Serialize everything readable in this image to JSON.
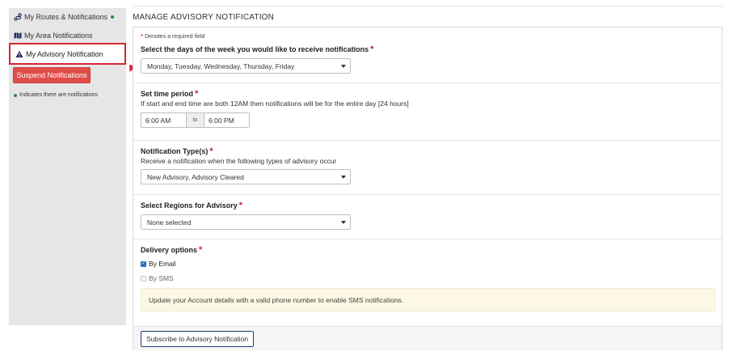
{
  "sidebar": {
    "items": [
      {
        "label": "My Routes & Notifications",
        "icon": "route-icon",
        "has_notifications": true
      },
      {
        "label": "My Area Notifications",
        "icon": "map-icon",
        "has_notifications": false
      },
      {
        "label": "My Advisory Notification",
        "icon": "warning-icon",
        "active": true
      }
    ],
    "suspend_button": "Suspend Notifications",
    "legend": "Indicates there are notifications",
    "notification_dot_color": "#2e8b3a"
  },
  "main": {
    "title": "MANAGE ADVISORY NOTIFICATION",
    "required_note": "Denotes a required field",
    "required_star": "*",
    "days": {
      "label": "Select the days of the week you would like to receive notifications",
      "value": "Monday, Tuesday, Wednesday, Thursday, Friday"
    },
    "time_period": {
      "label": "Set time period",
      "help": "If start and end time are both 12AM then notifications will be for the entire day [24 hours]",
      "start": "6:00 AM",
      "separator": "to",
      "end": "6:00 PM"
    },
    "types": {
      "label": "Notification Type(s)",
      "help": "Receive a notification when the following types of advisory occur",
      "value": "New Advisory, Advisory Cleared"
    },
    "regions": {
      "label": "Select Regions for Advisory",
      "value": "None selected"
    },
    "delivery": {
      "label": "Delivery options",
      "email": {
        "label": "By Email",
        "checked": true
      },
      "sms": {
        "label": "By SMS",
        "checked": false,
        "disabled": true
      },
      "alert": "Update your Account details with a valid phone number to enable SMS notifications."
    },
    "subscribe_button": "Subscribe to Advisory Notification"
  },
  "colors": {
    "accent_red": "#d3272d",
    "suspend_button": "#e04d48",
    "required_star": "#c8202a",
    "alert_bg": "#fcf8e3",
    "checkbox_checked": "#2371c8"
  }
}
